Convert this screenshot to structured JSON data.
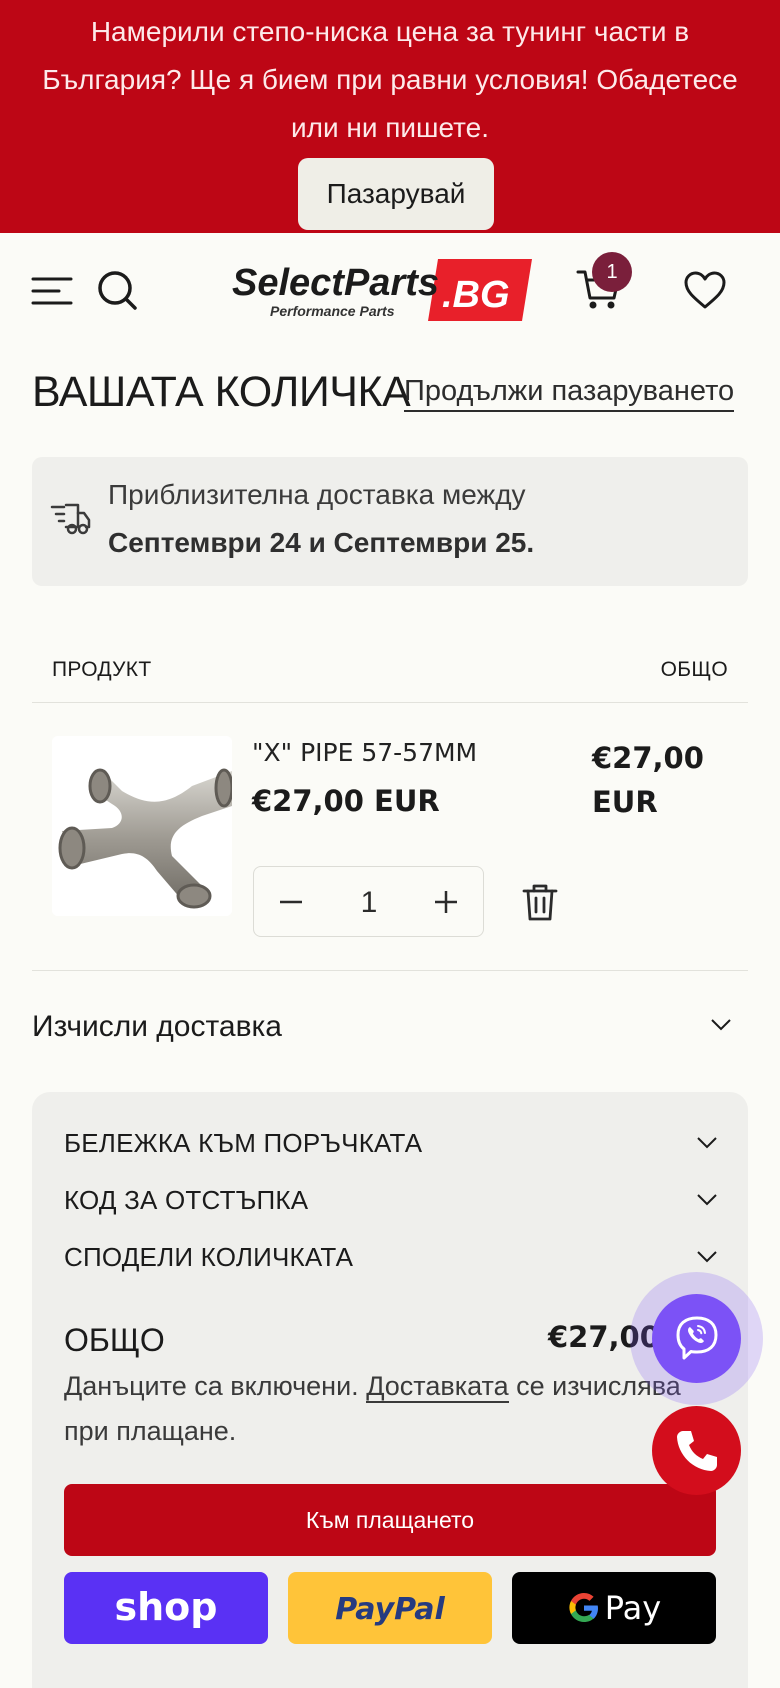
{
  "announcement": {
    "text": "Намерили степо-ниска цена за тунинг части в България? Ще я бием при равни условия! Обадетесе или ни пишете.",
    "button_label": "Пазарувай"
  },
  "header": {
    "logo_main": "SelectParts",
    "logo_suffix": ".BG",
    "logo_tagline": "Performance Parts",
    "cart_count": "1",
    "icons": [
      "menu-icon",
      "search-icon",
      "cart-icon",
      "heart-icon"
    ]
  },
  "cart": {
    "title": "ВАШАТА КОЛИЧКА",
    "continue_link": "Продължи пазаруването",
    "delivery_text": "Приблизителна доставка между",
    "delivery_dates": "Септември 24 и Септември 25.",
    "col_product": "ПРОДУКТ",
    "col_total": "ОБЩО",
    "items": [
      {
        "name": "\"X\" PIPE 57-57MM",
        "price": "€27,00 EUR",
        "total": "€27,00 EUR",
        "quantity": "1"
      }
    ]
  },
  "shipping_calc": {
    "label": "Изчисли доставка"
  },
  "summary": {
    "accordion": [
      "БЕЛЕЖКА КЪМ ПОРЪЧКАТА",
      "КОД ЗА ОТСТЪПКА",
      "СПОДЕЛИ КОЛИЧКАТА"
    ],
    "total_label": "ОБЩО",
    "total_value": "€27,00",
    "tax_note_before": "Данъците са включени. ",
    "tax_note_link": "Доставката",
    "tax_note_after": " се изчислява при плащане.",
    "checkout_label": "Към плащането",
    "pay_shop": "shop",
    "pay_paypal": "PayPal",
    "pay_gpay": "Pay"
  },
  "colors": {
    "brand_red": "#bd0615",
    "viber": "#7c52f6",
    "badge": "#7a1f3b",
    "shop_pay": "#5a31f4",
    "paypal": "#ffc439"
  }
}
